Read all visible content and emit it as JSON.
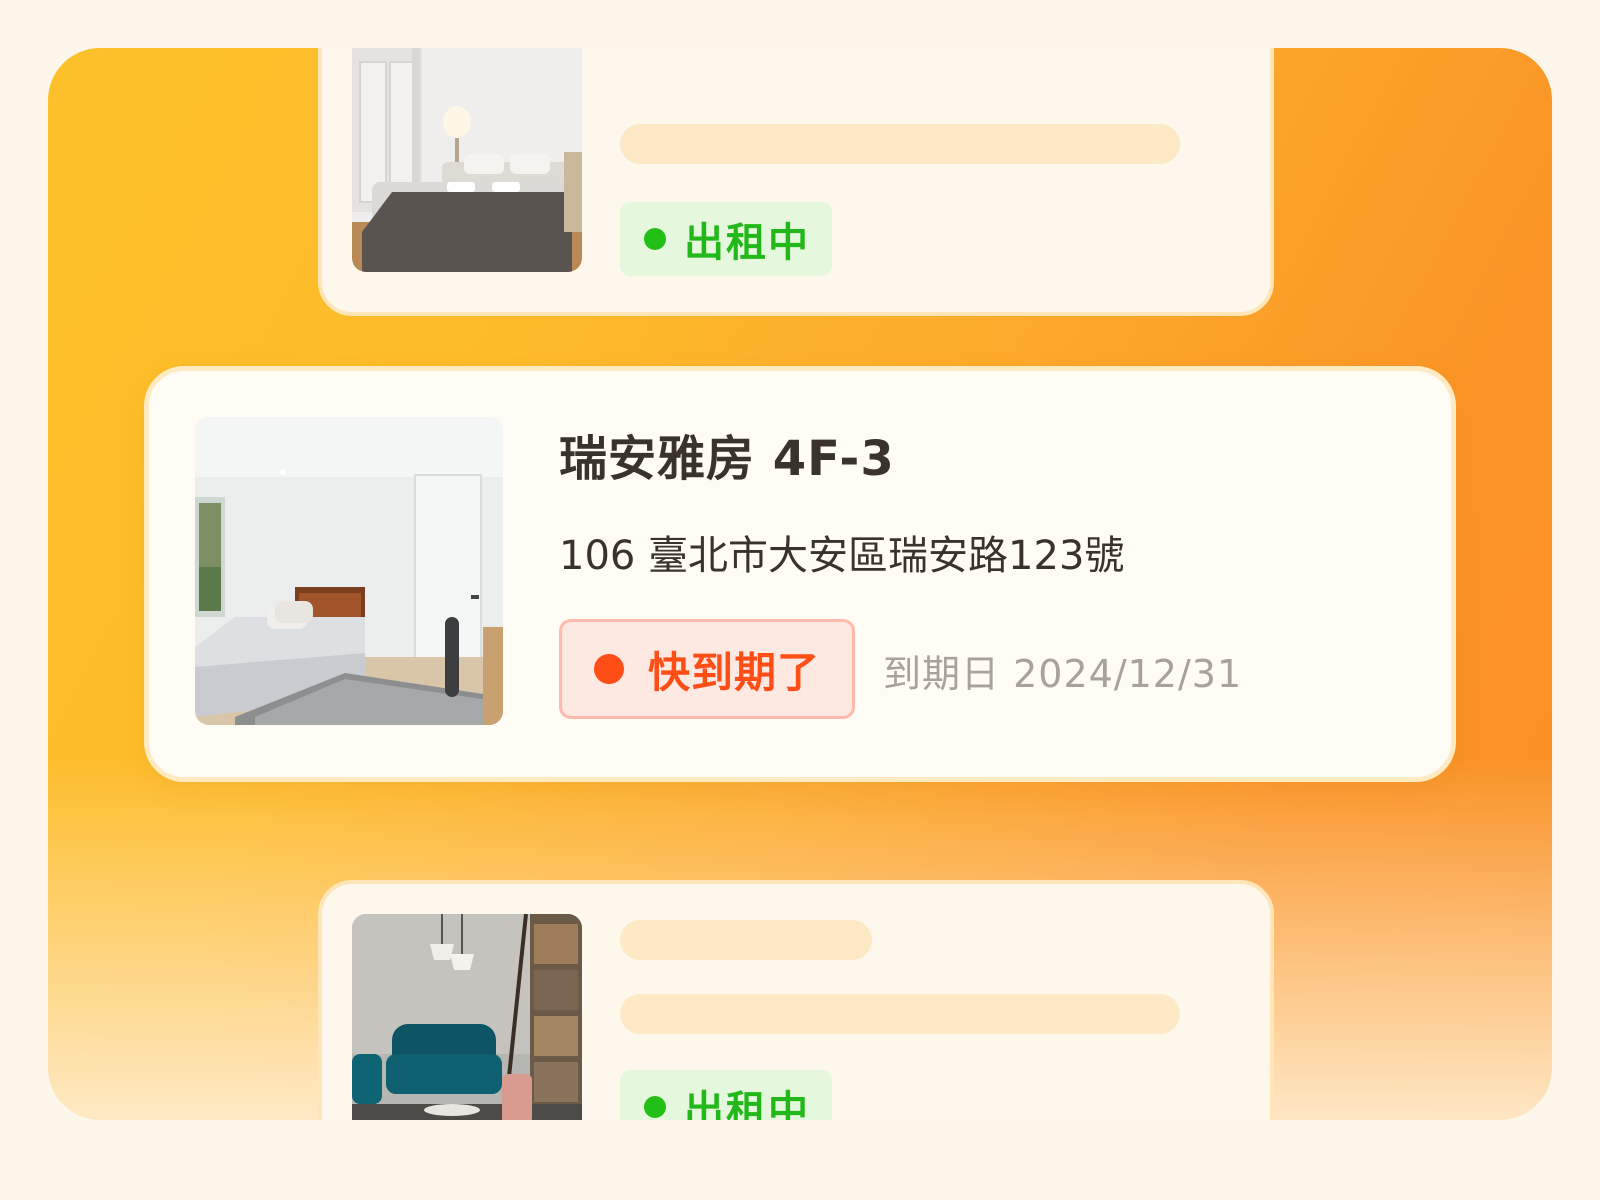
{
  "listings": [
    {
      "status_label": "出租中",
      "photo_icon": "bedroom-photo-dark-bed"
    },
    {
      "title": "瑞安雅房 4F-3",
      "address": "106 臺北市大安區瑞安路123號",
      "status_label": "快到期了",
      "due_label": "到期日",
      "due_date": "2024/12/31",
      "photo_icon": "bedroom-photo-bright"
    },
    {
      "status_label": "出租中",
      "photo_icon": "living-room-photo-blue-sofa"
    }
  ],
  "colors": {
    "accent_orange": "#f98f24",
    "accent_yellow": "#fcc12a",
    "status_active": "#22c016",
    "status_expiring": "#ff4d16"
  }
}
